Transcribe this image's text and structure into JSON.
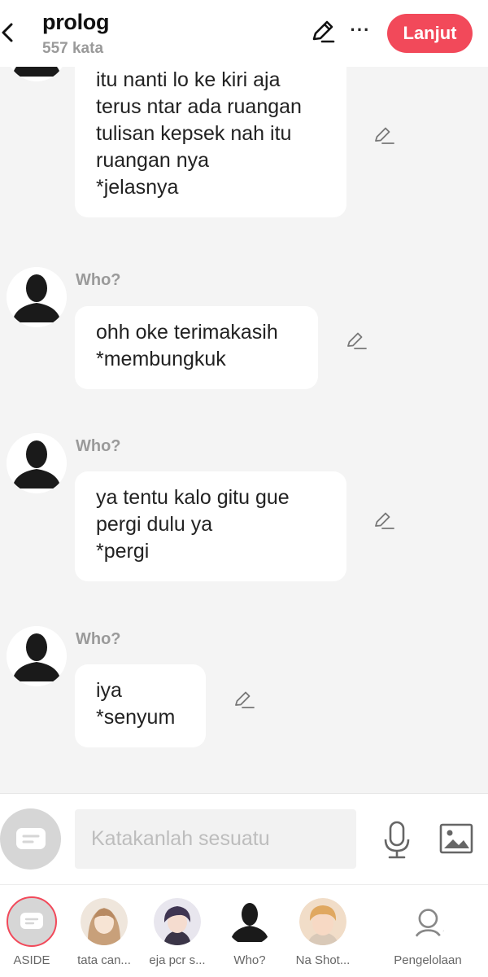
{
  "header": {
    "title": "prolog",
    "subtitle": "557 kata",
    "next_label": "Lanjut"
  },
  "messages": [
    {
      "speaker": "",
      "lines": [
        "itu nanti lo ke kiri aja",
        "terus ntar ada ruangan",
        "tulisan kepsek nah itu",
        "ruangan nya",
        "*jelasnya"
      ]
    },
    {
      "speaker": "Who?",
      "lines": [
        "ohh oke terimakasih",
        "*membungkuk"
      ]
    },
    {
      "speaker": "Who?",
      "lines": [
        "ya tentu kalo gitu gue",
        "pergi dulu ya",
        "*pergi"
      ]
    },
    {
      "speaker": "Who?",
      "lines": [
        "iya",
        "*senyum"
      ]
    }
  ],
  "composer": {
    "placeholder": "Katakanlah sesuatu"
  },
  "characters": [
    {
      "label": "ASIDE"
    },
    {
      "label": "tata can..."
    },
    {
      "label": "eja pcr s..."
    },
    {
      "label": "Who?"
    },
    {
      "label": "Na Shot..."
    },
    {
      "label": "Pengelolaan"
    }
  ],
  "colors": {
    "accent": "#f2495a",
    "background": "#f4f4f4",
    "muted_text": "#9a9a9a"
  },
  "icons": [
    "back-icon",
    "edit-icon",
    "more-icon",
    "chat-bubble-icon",
    "microphone-icon",
    "image-icon",
    "settings-user-icon"
  ]
}
